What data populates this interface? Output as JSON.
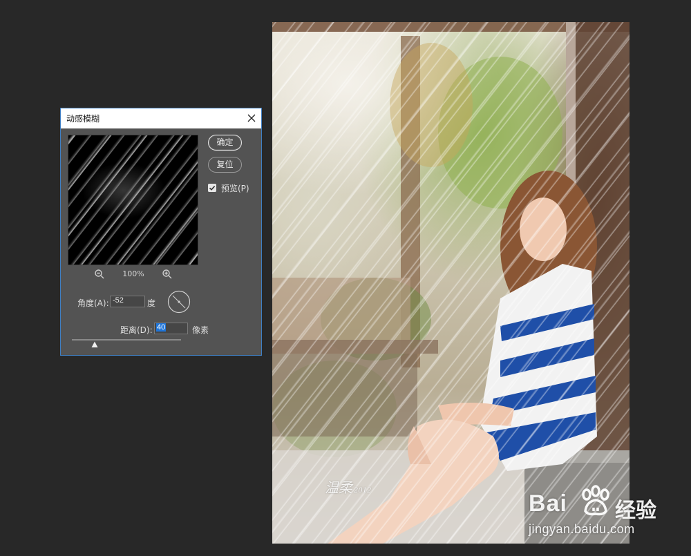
{
  "dialog": {
    "title": "动感模糊",
    "ok_label": "确定",
    "reset_label": "复位",
    "preview_label": "预览(P)",
    "preview_checked": true,
    "zoom_level": "100%",
    "angle_label": "角度(A):",
    "angle_value": "-52",
    "angle_unit": "度",
    "distance_label": "距离(D):",
    "distance_value": "40",
    "distance_unit": "像素"
  },
  "photo": {
    "signature": "温柔",
    "signature_small": "2012"
  },
  "watermark": {
    "logo_word": "Bai",
    "logo_cn": "经验",
    "url": "jingyan.baidu.com"
  },
  "colors": {
    "workspace": "#282828",
    "dialog_bg": "#535353",
    "dialog_border": "#3f7fc4",
    "selection": "#1e74d8",
    "dress_blue": "#1f4fa8"
  },
  "icons": {
    "close": "close-icon",
    "zoom_out": "zoom-out-icon",
    "zoom_in": "zoom-in-icon",
    "check": "checkmark-icon",
    "dial": "angle-dial-icon",
    "slider_thumb": "slider-triangle-icon",
    "paw": "baidu-paw-icon"
  }
}
